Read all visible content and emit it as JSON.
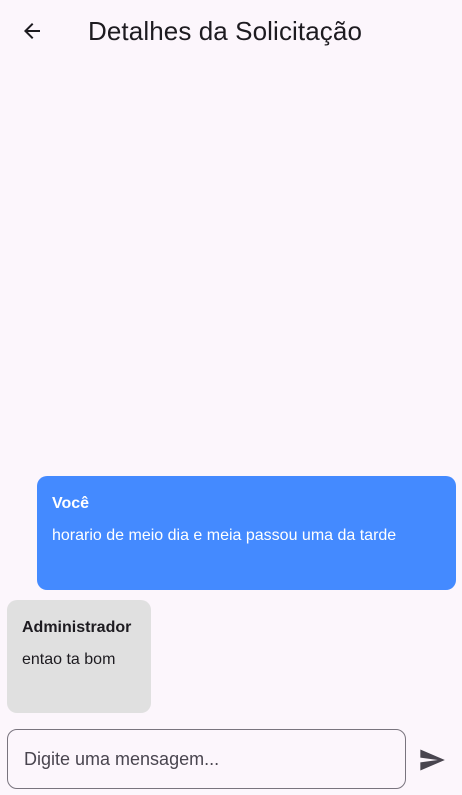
{
  "appbar": {
    "title": "Detalhes da Solicitação",
    "back_icon": "arrow-back-icon"
  },
  "messages": [
    {
      "sender": "Você",
      "text": "horario de meio dia e meia passou uma da tarde",
      "color": "#448AFF",
      "text_color": "#FFFFFF"
    },
    {
      "sender": "Administrador",
      "text": "entao ta bom",
      "color": "#E0E0E0",
      "text_color": "#1D1B20"
    }
  ],
  "composer": {
    "placeholder": "Digite uma mensagem...",
    "value": "",
    "send_icon": "send-icon"
  },
  "colors": {
    "background": "#FCF6FC",
    "accent": "#448AFF",
    "icon": "#49454F"
  }
}
